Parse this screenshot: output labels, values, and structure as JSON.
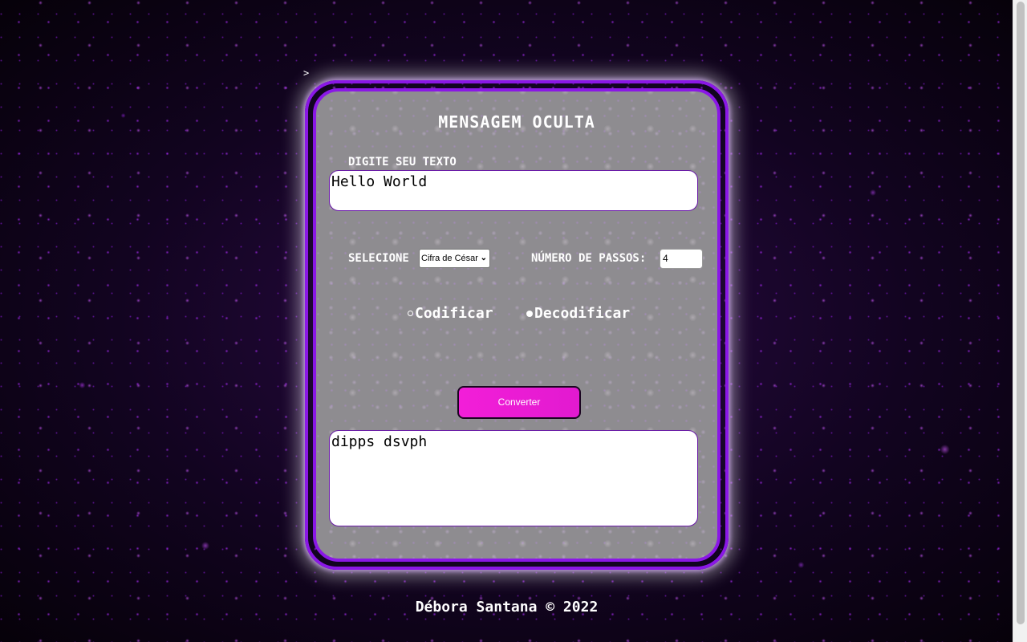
{
  "page": {
    "stray_mark": ">"
  },
  "card": {
    "title": "MENSAGEM OCULTA",
    "text_label": "DIGITE SEU TEXTO",
    "input_text": "Hello World",
    "select_label": "SELECIONE",
    "method_selected": "Cifra de César",
    "steps_label": "NÚMERO DE PASSOS:",
    "steps_value": "4",
    "encode_label": "Codificar",
    "decode_label": "Decodificar",
    "encode_checked": false,
    "decode_checked": true,
    "convert_label": "Converter",
    "output_text": "dipps dsvph"
  },
  "footer": {
    "text": "Débora Santana © 2022"
  },
  "icons": {
    "select_chevron": "chevron-down-icon",
    "radio_unchecked": "radio-unchecked-icon",
    "radio_checked": "radio-checked-icon"
  },
  "colors": {
    "border_purple": "#8a17e6",
    "card_gray": "#8e8c90",
    "button_magenta": "#f21ed8",
    "text_white": "#ffffff"
  }
}
